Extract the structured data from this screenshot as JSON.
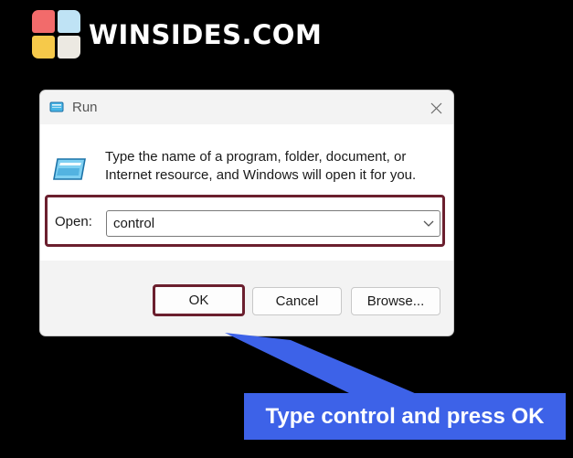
{
  "brand": {
    "name": "WINSIDES.COM",
    "logo_icon": "windows-four-squares-logo",
    "logo_colors": [
      "#f26b6b",
      "#bfe3f5",
      "#f6c94a",
      "#ece9e2"
    ]
  },
  "dialog": {
    "title": "Run",
    "title_icon": "run-app-icon",
    "close_icon": "close-icon",
    "app_icon": "run-app-icon",
    "description": "Type the name of a program, folder, document, or Internet resource, and Windows will open it for you.",
    "open_label": "Open:",
    "open_value": "control",
    "dropdown_icon": "chevron-down-icon",
    "buttons": {
      "ok": "OK",
      "cancel": "Cancel",
      "browse": "Browse..."
    },
    "highlight_color": "#6b1f2e"
  },
  "callout": {
    "text": "Type control and press OK",
    "color": "#3d62e8"
  }
}
